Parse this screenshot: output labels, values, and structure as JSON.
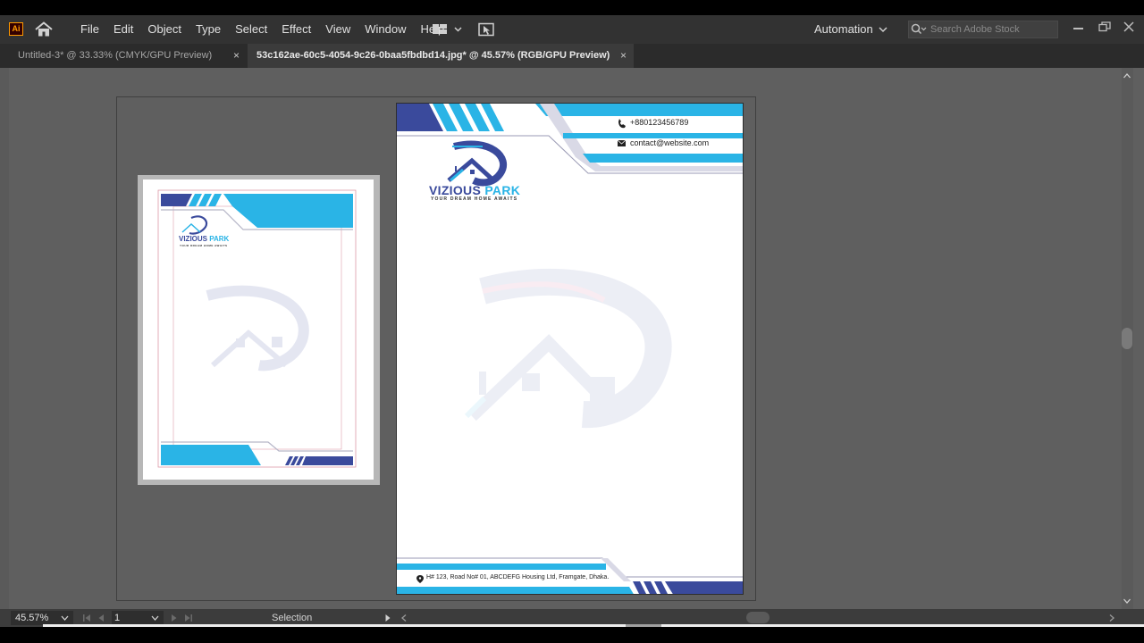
{
  "app": {
    "logo_text": "Ai"
  },
  "menu": {
    "items": [
      "File",
      "Edit",
      "Object",
      "Type",
      "Select",
      "Effect",
      "View",
      "Window",
      "Help"
    ],
    "automation_label": "Automation",
    "search_placeholder": "Search Adobe Stock"
  },
  "tabs": [
    {
      "label": "Untitled-3* @ 33.33% (CMYK/GPU Preview)",
      "active": false
    },
    {
      "label": "53c162ae-60c5-4054-9c26-0baa5fbdbd14.jpg* @ 45.57% (RGB/GPU Preview)",
      "active": true
    }
  ],
  "tab_close_glyph": "×",
  "letterhead": {
    "phone": "+880123456789",
    "email": "contact@website.com",
    "brand_part1": "VIZIOUS",
    "brand_part2": "PARK",
    "tagline": "YOUR DREAM HOME AWAITS",
    "address": "H# 123, Road No# 01, ABCDEFG Housing Ltd, Framgate, Dhaka.",
    "colors": {
      "navy": "#3a4a9c",
      "cyan": "#2ab4e6",
      "gray": "#d9d9e6"
    }
  },
  "status": {
    "zoom": "45.57%",
    "artboard": "1",
    "tool": "Selection"
  }
}
